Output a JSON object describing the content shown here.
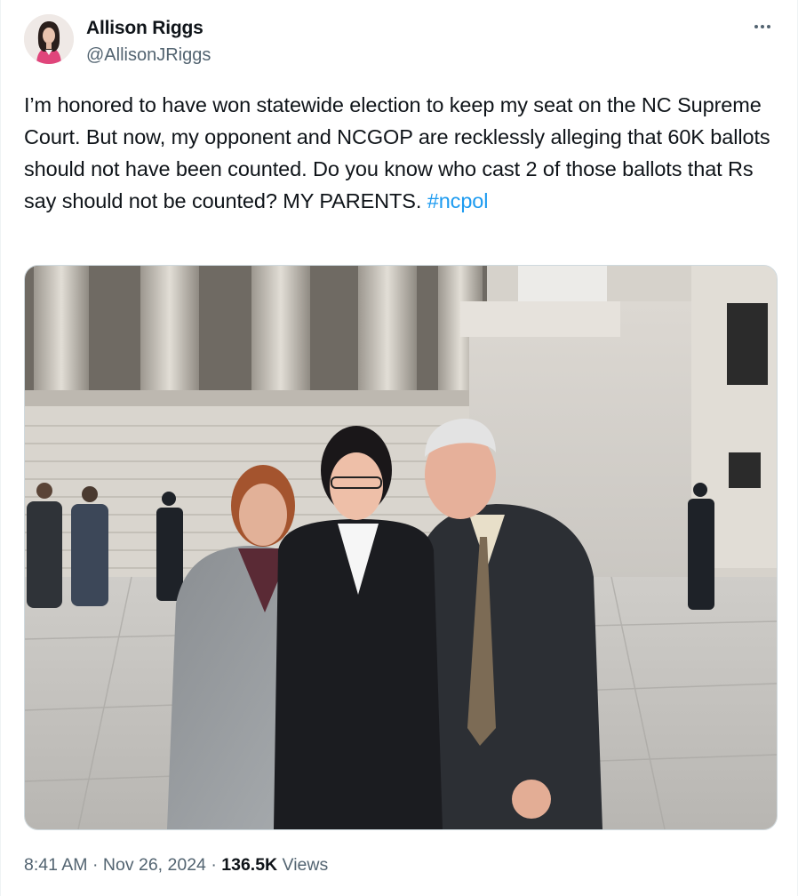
{
  "author": {
    "name": "Allison Riggs",
    "handle": "@AllisonJRiggs",
    "avatar_icon": "profile-photo"
  },
  "more_icon": "more-horizontal-icon",
  "tweet": {
    "text": "I’m honored to have won statewide election to keep my seat on the NC Supreme Court. But now, my opponent and NCGOP are recklessly alleging that 60K ballots should not have been counted. Do you know who cast 2 of those ballots that Rs say should not be counted? MY PARENTS. ",
    "hashtag": "#ncpol",
    "link_color": "#1d9bf0"
  },
  "media": {
    "kind": "photo"
  },
  "meta": {
    "time": "8:41 AM",
    "sep1": " · ",
    "date": "Nov 26, 2024",
    "sep2": " · ",
    "views_count": "136.5K",
    "views_label": " Views"
  }
}
